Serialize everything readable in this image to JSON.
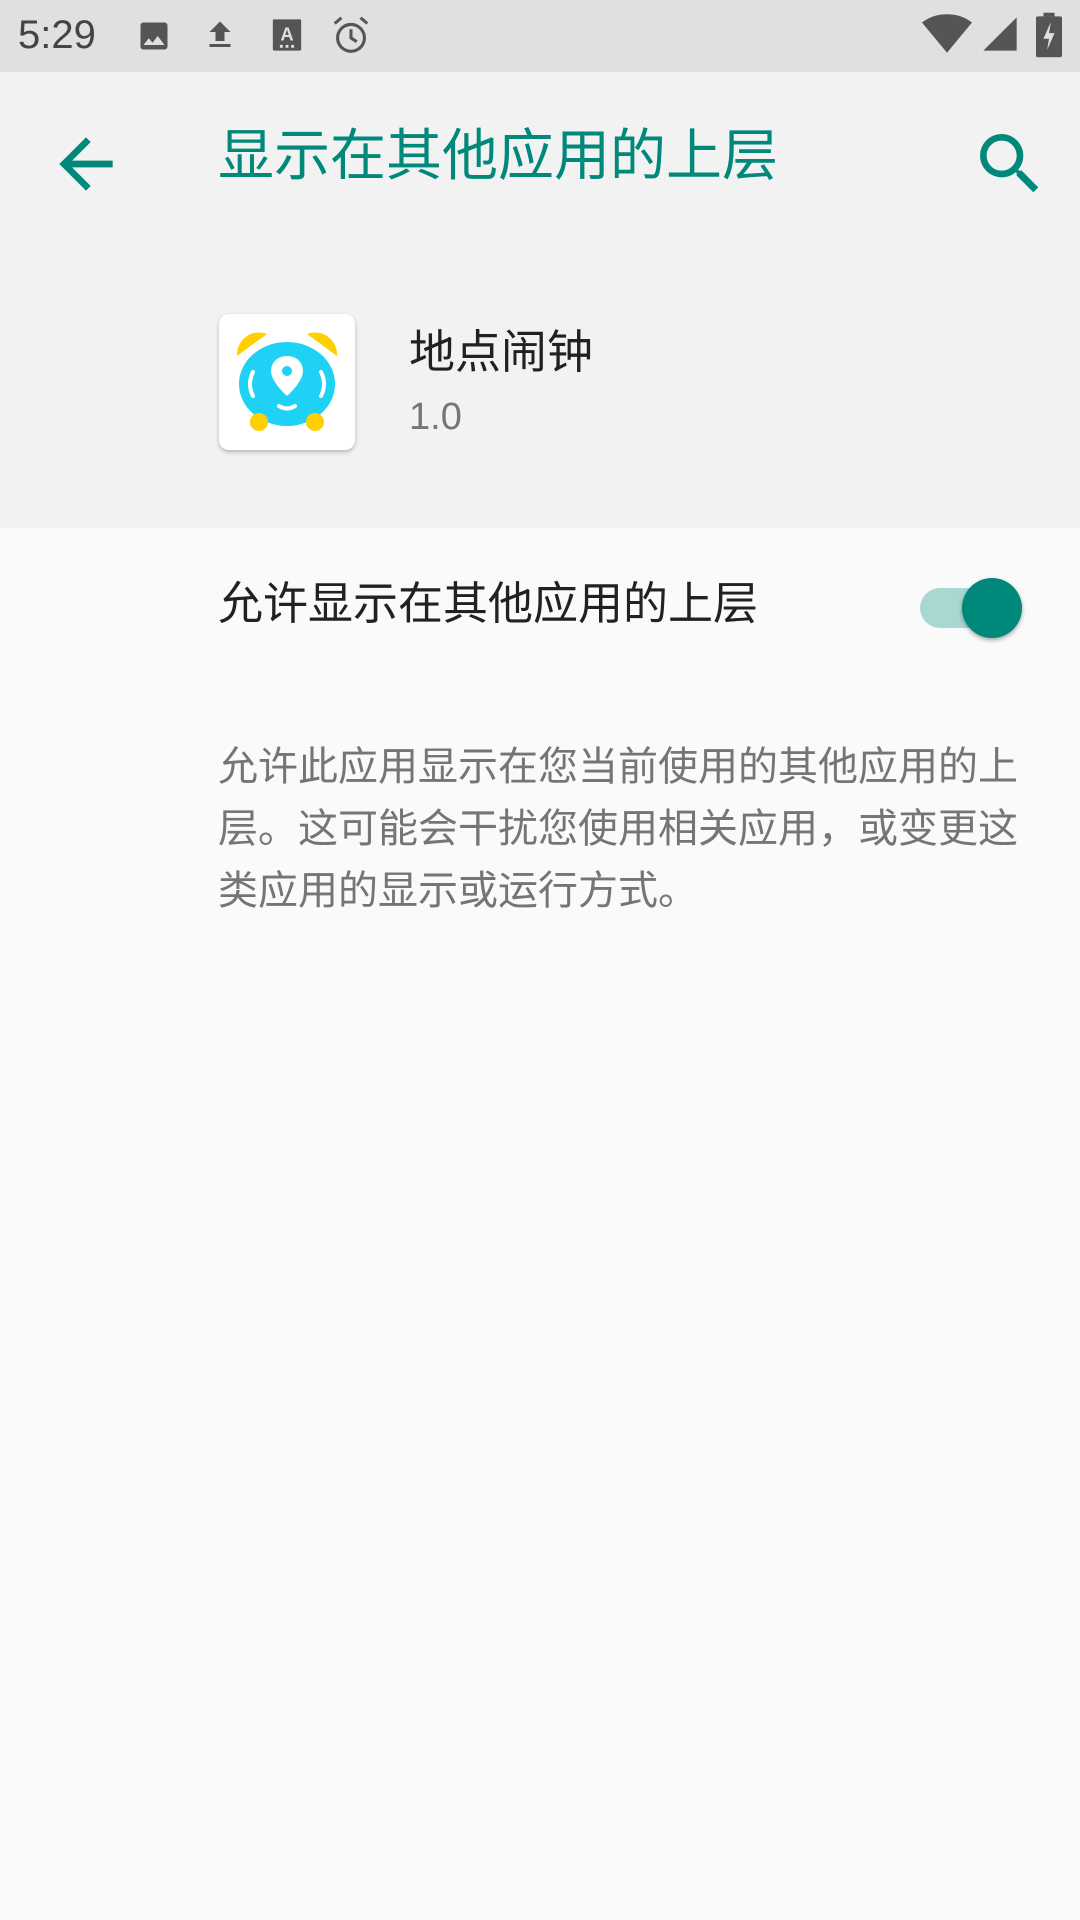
{
  "status_bar": {
    "time": "5:29",
    "left_icons": [
      "image-icon",
      "upload-icon",
      "text-a-icon",
      "alarm-icon"
    ],
    "right_icons": [
      "wifi-icon",
      "signal-icon",
      "battery-charging-icon"
    ]
  },
  "app_bar": {
    "title": "显示在其他应用的上层",
    "back_icon": "arrow-back-icon",
    "search_icon": "search-icon",
    "accent_color": "#00897b"
  },
  "app_info": {
    "name": "地点闹钟",
    "version": "1.0",
    "icon": "location-alarm-clock-icon"
  },
  "permission": {
    "label": "允许显示在其他应用的上层",
    "enabled": true,
    "description": "允许此应用显示在您当前使用的其他应用的上层。这可能会干扰您使用相关应用，或变更这类应用的显示或运行方式。"
  }
}
